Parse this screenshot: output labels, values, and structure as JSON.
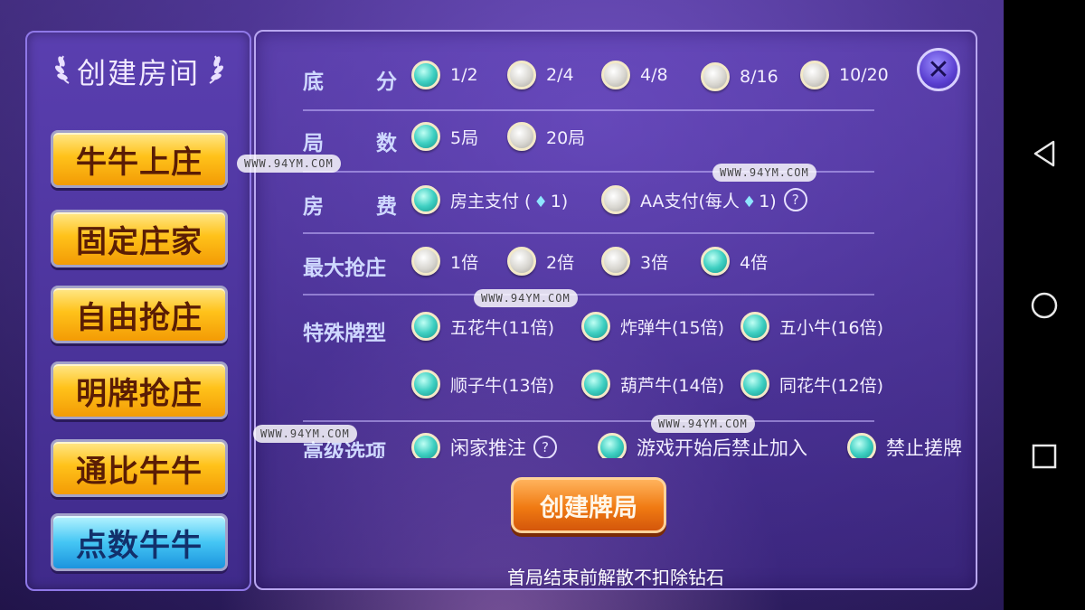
{
  "left_panel": {
    "title": "创建房间",
    "games": [
      {
        "label": "牛牛上庄",
        "active": false
      },
      {
        "label": "固定庄家",
        "active": false
      },
      {
        "label": "自由抢庄",
        "active": false
      },
      {
        "label": "明牌抢庄",
        "active": false
      },
      {
        "label": "通比牛牛",
        "active": false
      },
      {
        "label": "点数牛牛",
        "active": true
      }
    ]
  },
  "settings": {
    "base_score": {
      "label_a": "底",
      "label_b": "分",
      "options": [
        "1/2",
        "2/4",
        "4/8",
        "8/16",
        "10/20"
      ],
      "selected": "1/2"
    },
    "rounds": {
      "label_a": "局",
      "label_b": "数",
      "options": [
        "5局",
        "20局"
      ],
      "selected": "5局"
    },
    "room_fee": {
      "label_a": "房",
      "label_b": "费",
      "owner_pay": {
        "prefix": "房主支付 (",
        "suffix": "1)"
      },
      "aa_pay": {
        "prefix": "AA支付(每人",
        "suffix": "1)"
      },
      "selected": "owner_pay"
    },
    "max_grab": {
      "label": "最大抢庄",
      "options": [
        "1倍",
        "2倍",
        "3倍",
        "4倍"
      ],
      "selected": "4倍"
    },
    "special_cards": {
      "label": "特殊牌型",
      "row1": [
        "五花牛(11倍)",
        "炸弹牛(15倍)",
        "五小牛(16倍)"
      ],
      "row2": [
        "顺子牛(13倍)",
        "葫芦牛(14倍)",
        "同花牛(12倍)"
      ],
      "all_selected": true
    },
    "advanced": {
      "label": "高级选项",
      "options": [
        "闲家推注",
        "游戏开始后禁止加入",
        "禁止搓牌"
      ]
    }
  },
  "create_button": "创建牌局",
  "notice": "首局结束前解散不扣除钻石",
  "watermarks": [
    "WWW.94YM.COM",
    "WWW.94YM.COM",
    "WWW.94YM.COM",
    "WWW.94YM.COM",
    "WWW.94YM.COM"
  ],
  "icons": {
    "close": "close-icon",
    "diamond": "diamond-icon",
    "help": "help-icon",
    "back": "back-nav-icon",
    "home": "home-nav-icon",
    "recents": "recents-nav-icon"
  }
}
